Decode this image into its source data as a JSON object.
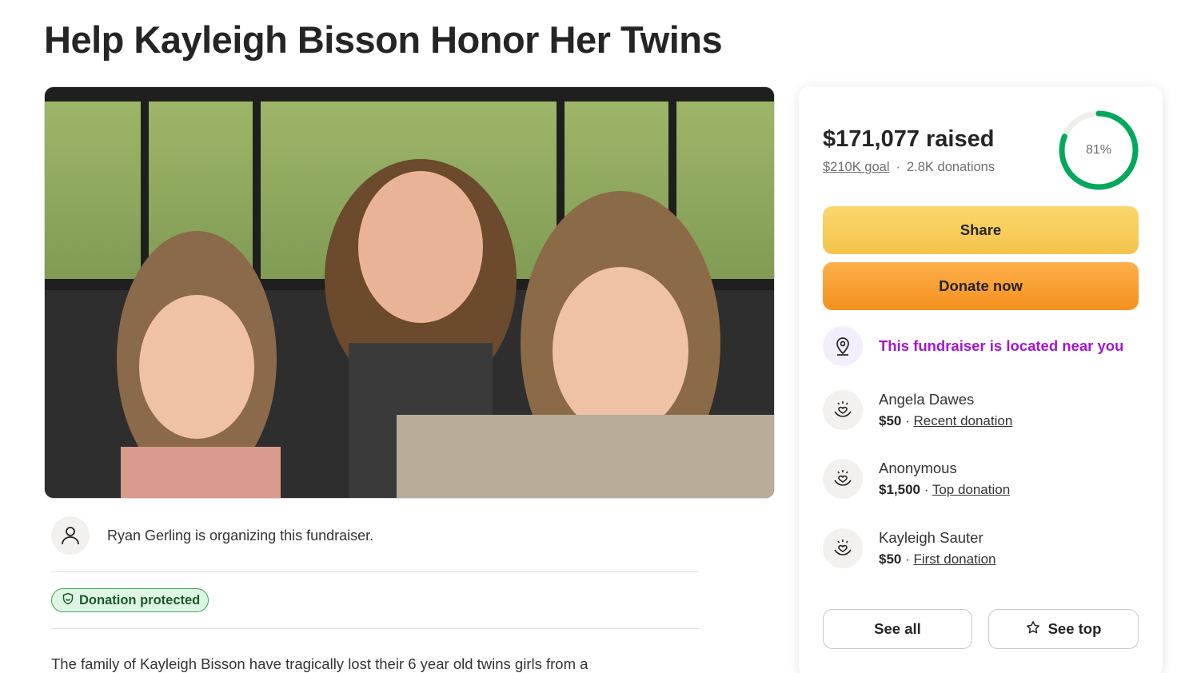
{
  "page": {
    "title": "Help Kayleigh Bisson Honor Her Twins"
  },
  "organizer": {
    "text": "Ryan Gerling is organizing this fundraiser."
  },
  "protection_badge": {
    "label": "Donation protected"
  },
  "story": {
    "excerpt": "The family of Kayleigh Bisson have tragically lost their 6 year old twins girls from a"
  },
  "donation_card": {
    "raised": "$171,077 raised",
    "goal": "$210K goal",
    "separator": "·",
    "donations": "2.8K donations",
    "progress_label": "81%",
    "progress_fraction": 0.81,
    "share_label": "Share",
    "donate_label": "Donate now",
    "near_you": "This fundraiser is located near you",
    "donors": [
      {
        "name": "Angela Dawes",
        "amount": "$50",
        "kind": "Recent donation"
      },
      {
        "name": "Anonymous",
        "amount": "$1,500",
        "kind": "Top donation"
      },
      {
        "name": "Kayleigh Sauter",
        "amount": "$50",
        "kind": "First donation"
      }
    ],
    "see_all_label": "See all",
    "see_top_label": "See top"
  },
  "colors": {
    "progress": "#02a95c",
    "progress_track": "#eeeeec",
    "accent_purple": "#a416d4",
    "share_button": "#f6c850",
    "donate_button": "#f89a2a",
    "badge_green": "#37a85a"
  },
  "icons": {
    "organizer": "person-icon",
    "badge": "shield-icon",
    "near": "location-pin-icon",
    "donor": "heart-hands-icon",
    "see_top": "star-icon"
  }
}
